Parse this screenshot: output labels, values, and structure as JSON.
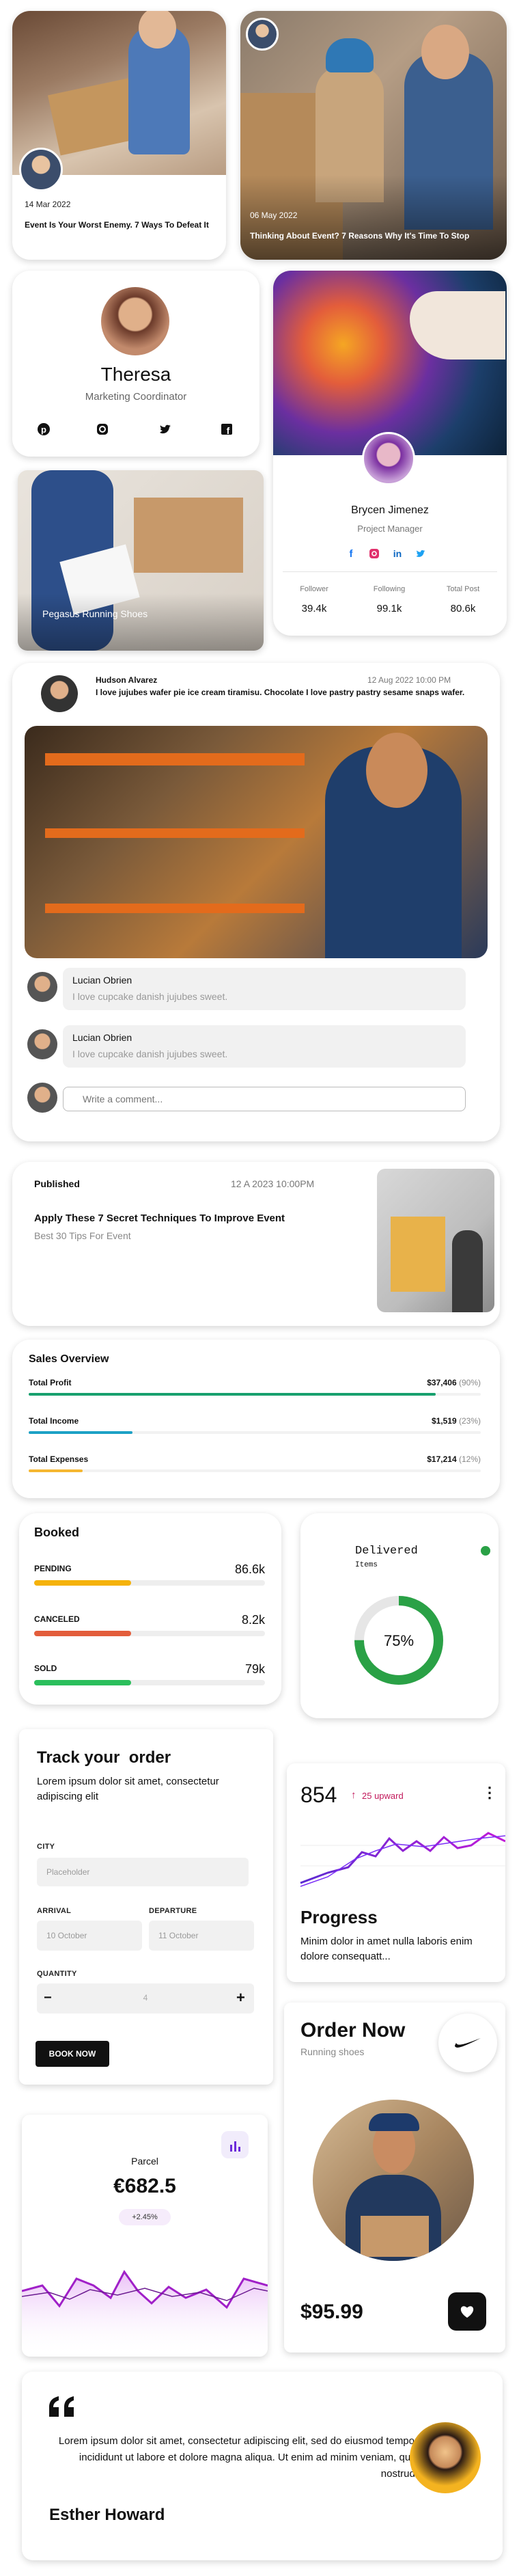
{
  "colors": {
    "orange": "#f59e0b",
    "red": "#e35d3b",
    "green": "#2aa146",
    "teal": "#17a06e",
    "cyan": "#1da1c5",
    "purple": "#7b2ff7"
  },
  "card1": {
    "date": "14 Mar 2022",
    "title": "Event Is Your Worst Enemy. 7 Ways To Defeat It"
  },
  "card2": {
    "date": "06 May 2022",
    "title": "Thinking About Event? 7 Reasons Why It's Time To Stop"
  },
  "profile1": {
    "name": "Theresa",
    "role": "Marketing Coordinator",
    "socials": [
      "pinterest-icon",
      "instagram-icon",
      "twitter-icon",
      "facebook-icon"
    ]
  },
  "profile2": {
    "name": "Brycen Jimenez",
    "role": "Project Manager",
    "socials": [
      "facebook-icon",
      "instagram-icon",
      "linkedin-icon",
      "twitter-icon"
    ],
    "stats": [
      {
        "label": "Follower",
        "value": "39.4k"
      },
      {
        "label": "Following",
        "value": "99.1k"
      },
      {
        "label": "Total Post",
        "value": "80.6k"
      }
    ]
  },
  "product": {
    "caption": "Pegasus Running Shoes"
  },
  "post": {
    "author": "Hudson Alvarez",
    "date": "12 Aug 2022 10:00 PM",
    "text": "I love jujubes wafer pie ice cream tiramisu. Chocolate I love pastry pastry sesame snaps wafer.",
    "comments": [
      {
        "name": "Lucian Obrien",
        "text": "I love cupcake danish jujubes sweet."
      },
      {
        "name": "Lucian Obrien",
        "text": "I love cupcake danish jujubes sweet."
      }
    ],
    "comment_placeholder": "Write a comment..."
  },
  "published": {
    "label": "Published",
    "date": "12 A 2023 10:00PM",
    "title": "Apply These 7 Secret Techniques To Improve Event",
    "subtitle": "Best 30 Tips For Event"
  },
  "sales": {
    "title": "Sales Overview",
    "rows": [
      {
        "label": "Total Profit",
        "value": "$37,406",
        "pct": "(90%)",
        "fraction": 0.9,
        "color": "#17a06e"
      },
      {
        "label": "Total Income",
        "value": "$1,519",
        "pct": "(23%)",
        "fraction": 0.23,
        "color": "#1da1c5"
      },
      {
        "label": "Total Expenses",
        "value": "$17,214",
        "pct": "(12%)",
        "fraction": 0.12,
        "color": "#f5b731"
      }
    ]
  },
  "booked": {
    "title": "Booked",
    "rows": [
      {
        "label": "PENDING",
        "value": "86.6k",
        "fraction": 0.42,
        "color": "#f5b20b"
      },
      {
        "label": "CANCELED",
        "value": "8.2k",
        "fraction": 0.42,
        "color": "#e35d3b"
      },
      {
        "label": "SOLD",
        "value": "79k",
        "fraction": 0.42,
        "color": "#2bbf5c"
      }
    ]
  },
  "delivered": {
    "title": "Delivered",
    "subtitle": "Items",
    "percent_label": "75%",
    "fraction": 0.75
  },
  "order": {
    "title": "Track your  order",
    "desc": "Lorem ipsum dolor sit amet, consectetur adipiscing elit",
    "city_label": "CITY",
    "city_placeholder": "Placeholder",
    "arrival_label": "ARRIVAL",
    "arrival_value": "10 October",
    "departure_label": "DEPARTURE",
    "departure_value": "11 October",
    "quantity_label": "QUANTITY",
    "quantity_value": "4",
    "minus": "−",
    "plus": "+",
    "button": "BOOK NOW"
  },
  "progress": {
    "value": "854",
    "trend": "25 upward",
    "title": "Progress",
    "desc": "Minim dolor in amet nulla laboris enim dolore consequatt..."
  },
  "parcel": {
    "label": "Parcel",
    "value": "€682.5",
    "change": "+2.45%"
  },
  "order_now": {
    "title": "Order Now",
    "subtitle": "Running shoes",
    "price": "$95.99"
  },
  "testimonial": {
    "quote": "Lorem ipsum dolor sit amet, consectetur adipiscing elit, sed do eiusmod tempor incididunt ut labore et dolore magna aliqua. Ut enim ad minim veniam, quis nostrud.",
    "name": "Esther Howard"
  }
}
